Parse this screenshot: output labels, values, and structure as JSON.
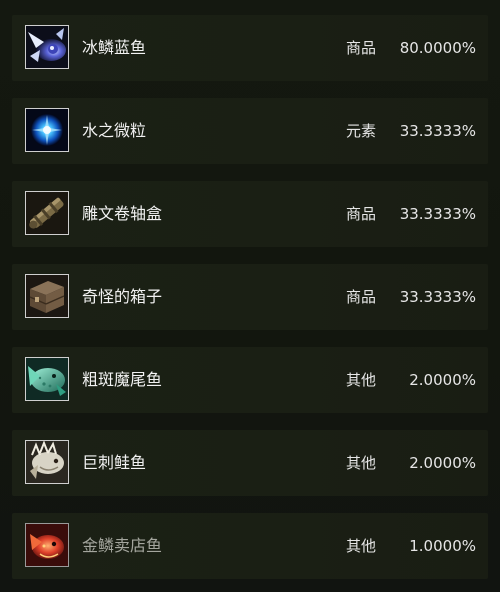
{
  "loot_list": {
    "items": [
      {
        "name": "冰鳞蓝鱼",
        "type": "商品",
        "rate": "80.0000%",
        "icon": "ice-scale-blue-fish-icon"
      },
      {
        "name": "水之微粒",
        "type": "元素",
        "rate": "33.3333%",
        "icon": "water-particle-icon"
      },
      {
        "name": "雕文卷轴盒",
        "type": "商品",
        "rate": "33.3333%",
        "icon": "glyph-scroll-case-icon"
      },
      {
        "name": "奇怪的箱子",
        "type": "商品",
        "rate": "33.3333%",
        "icon": "strange-box-icon"
      },
      {
        "name": "粗斑魔尾鱼",
        "type": "其他",
        "rate": "2.0000%",
        "icon": "spotted-feltail-icon"
      },
      {
        "name": "巨刺鲑鱼",
        "type": "其他",
        "rate": "2.0000%",
        "icon": "giant-spine-salmon-icon"
      },
      {
        "name": "金鳞卖店鱼",
        "type": "其他",
        "rate": "1.0000%",
        "icon": "golden-scale-vendor-fish-icon"
      }
    ]
  },
  "colors": {
    "background": "#12150f",
    "row_background": "#1b2015",
    "text_primary": "#f2f2f2",
    "text_dim": "#a4a69e",
    "icon_border": "#cfcfcf"
  }
}
